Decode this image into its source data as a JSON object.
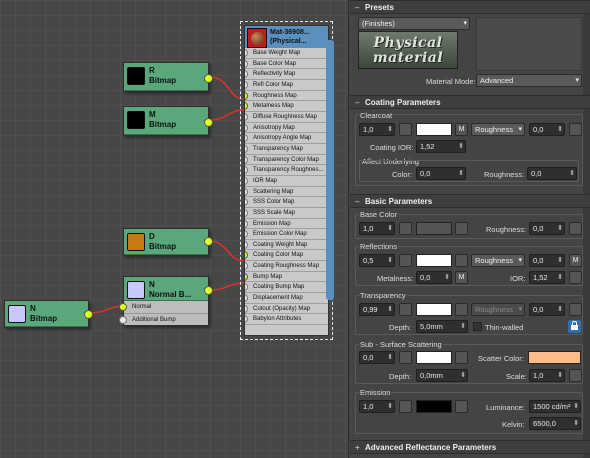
{
  "nodes": {
    "bitmap_r": {
      "letter": "R",
      "label": "Bitmap",
      "color": "#000000"
    },
    "bitmap_m": {
      "letter": "M",
      "label": "Bitmap",
      "color": "#000000"
    },
    "bitmap_d": {
      "letter": "D",
      "label": "Bitmap",
      "color": "#c77a0f"
    },
    "normal_bump": {
      "letter": "N",
      "label": "Normal B...",
      "color": "#c8c8ff",
      "slots": [
        "Normal",
        "Additional Bump"
      ]
    },
    "bitmap_n": {
      "letter": "N",
      "label": "Bitmap",
      "color": "#c8c8ff"
    }
  },
  "material": {
    "title_line1": "Mat-36908...",
    "title_line2": "(Physical...",
    "slots": [
      "Base Weight Map",
      "Base Color Map",
      "Reflectivity Map",
      "Refl Color Map",
      "Roughness Map",
      "Metalness Map",
      "Diffuse Roughness Map",
      "Anisotropy Map",
      "Anisotropy Angle Map",
      "Transparency Map",
      "Transparency Color Map",
      "Transparency Roughnes...",
      "IOR Map",
      "Scattering Map",
      "SSS Color Map",
      "SSS Scale Map",
      "Emission Map",
      "Emission Color Map",
      "Coating Weight Map",
      "Coating Color Map",
      "Coating Roughness Map",
      "Bump Map",
      "Coating Bump Map",
      "Displacement Map",
      "Cutout (Opacity) Map",
      "Babylon Attributes"
    ],
    "connected": [
      4,
      5,
      19,
      21
    ]
  },
  "panel": {
    "presets": {
      "title": "Presets",
      "dropdown": "(Finishes)",
      "logo_line1": "Physical",
      "logo_line2": "material",
      "mode_label": "Material Mode:",
      "mode_value": "Advanced"
    },
    "coating": {
      "title": "Coating Parameters",
      "group": "Clearcoat",
      "weight": "1,0",
      "m": "M",
      "rough_dd": "Roughness",
      "rough_val": "0,0",
      "ior_label": "Coating IOR:",
      "ior": "1,52",
      "affect": "Affect Underlying",
      "color_label": "Color:",
      "color_val": "0,0",
      "roughness_label": "Roughness:",
      "roughness_val": "0,0"
    },
    "basic": {
      "title": "Basic Parameters",
      "base_color": {
        "group": "Base Color",
        "weight": "1,0",
        "rough_label": "Roughness:",
        "rough_val": "0,0"
      },
      "reflections": {
        "group": "Reflections",
        "weight": "0,5",
        "rough_dd": "Roughness",
        "rough_val": "0,0",
        "m": "M",
        "metal_label": "Metalness:",
        "metal_val": "0,0",
        "ior_label": "IOR:",
        "ior_val": "1,52"
      },
      "transparency": {
        "group": "Transparency",
        "weight": "0,99",
        "rough_dd": "Roughness",
        "rough_val": "0,0",
        "depth_label": "Depth:",
        "depth_val": "5,0mm",
        "thin": "Thin-walled"
      },
      "sss": {
        "group": "Sub - Surface Scattering",
        "weight": "0,0",
        "scatter_label": "Scatter Color:",
        "depth_label": "Depth:",
        "depth_val": "0,0mm",
        "scale_label": "Scale:",
        "scale_val": "1,0"
      },
      "emission": {
        "group": "Emission",
        "weight": "1,0",
        "lum_label": "Luminance:",
        "lum_val": "1500 cd/m²",
        "kelvin_label": "Kelvin:",
        "kelvin_val": "6500,0"
      }
    },
    "advanced": {
      "title": "Advanced Reflectance Parameters"
    }
  },
  "colors": {
    "node_green": "#5aa77b",
    "material_blue": "#5a8fbe",
    "socket_yellow": "#dfff1e",
    "wire_red": "#e0302a",
    "scatter": "#ffbb88"
  }
}
